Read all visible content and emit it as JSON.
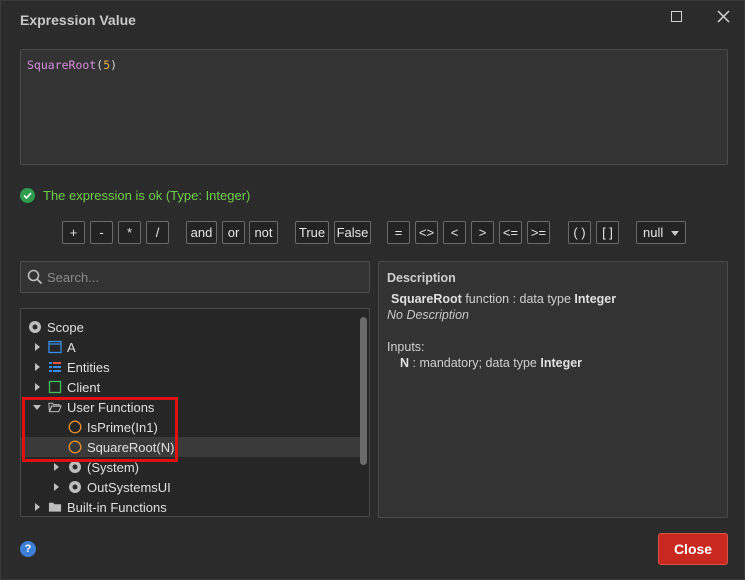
{
  "window": {
    "title": "Expression Value"
  },
  "editor": {
    "fn": "SquareRoot",
    "open": "(",
    "arg": "5",
    "close": ")"
  },
  "status": {
    "text": "The expression is ok (Type: Integer)"
  },
  "operators": {
    "plus": "+",
    "minus": "-",
    "mul": "*",
    "div": "/",
    "and": "and",
    "or": "or",
    "not": "not",
    "true": "True",
    "false": "False",
    "eq": "=",
    "neq": "<>",
    "lt": "<",
    "gt": ">",
    "lte": "<=",
    "gte": ">=",
    "paren": "( )",
    "brackets": "[ ]",
    "null": "null"
  },
  "search": {
    "placeholder": "Search..."
  },
  "tree": {
    "scope": "Scope",
    "a": "A",
    "entities": "Entities",
    "client": "Client",
    "user_functions": "User Functions",
    "isprime": "IsPrime(In1)",
    "squareroot": "SquareRoot(N)",
    "system": "(System)",
    "outsystemsui": "OutSystemsUI",
    "builtin": "Built-in Functions"
  },
  "description": {
    "heading": "Description",
    "fn_name": "SquareRoot",
    "fn_text": " function : data type ",
    "fn_type": "Integer",
    "no_desc": "No Description",
    "inputs_label": "Inputs:",
    "input_name": "N",
    "input_text": " : mandatory; data type ",
    "input_type": "Integer"
  },
  "footer": {
    "help": "?",
    "close_label": "Close"
  },
  "colors": {
    "accent_red": "#c8281e",
    "ok_green": "#6fcf4a",
    "highlight": "#e01010"
  }
}
